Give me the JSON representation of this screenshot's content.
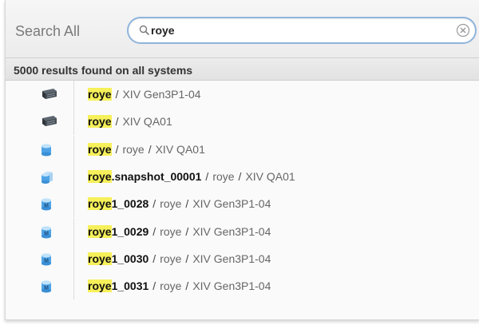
{
  "search": {
    "label": "Search All",
    "query": "roye"
  },
  "results_summary": "5000 results found on all systems",
  "highlight_color": "#f6f05a",
  "results": [
    {
      "icon": "system-icon",
      "highlight": "roye",
      "name_rest": "",
      "path": [
        "XIV Gen3P1-04"
      ]
    },
    {
      "icon": "system-icon",
      "highlight": "roye",
      "name_rest": "",
      "path": [
        "XIV QA01"
      ]
    },
    {
      "icon": "pool-icon",
      "highlight": "roye",
      "name_rest": "",
      "path": [
        "roye",
        "XIV QA01"
      ]
    },
    {
      "icon": "snapshot-icon",
      "highlight": "roye",
      "name_rest": ".snapshot_00001",
      "path": [
        "roye",
        "XIV QA01"
      ]
    },
    {
      "icon": "volume-icon",
      "highlight": "roye",
      "name_rest": "1_0028",
      "path": [
        "roye",
        "XIV Gen3P1-04"
      ]
    },
    {
      "icon": "volume-icon",
      "highlight": "roye",
      "name_rest": "1_0029",
      "path": [
        "roye",
        "XIV Gen3P1-04"
      ]
    },
    {
      "icon": "volume-icon",
      "highlight": "roye",
      "name_rest": "1_0030",
      "path": [
        "roye",
        "XIV Gen3P1-04"
      ]
    },
    {
      "icon": "volume-icon",
      "highlight": "roye",
      "name_rest": "1_0031",
      "path": [
        "roye",
        "XIV Gen3P1-04"
      ]
    }
  ]
}
